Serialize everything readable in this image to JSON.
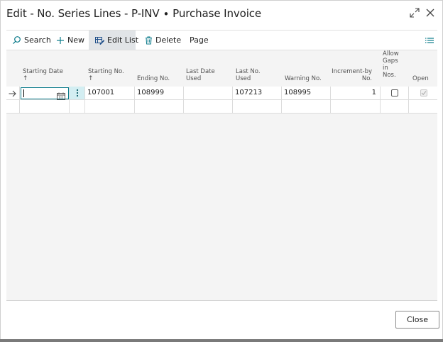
{
  "window": {
    "title": "Edit - No. Series Lines - P-INV ∙ Purchase Invoice"
  },
  "window_icons": [
    "expand-icon",
    "close-icon"
  ],
  "toolbar": {
    "search_label": "Search",
    "new_label": "New",
    "edit_list_label": "Edit List",
    "delete_label": "Delete",
    "page_label": "Page",
    "active_item": "Edit List"
  },
  "columns": {
    "starting_date": "Starting Date",
    "starting_date_sort": "↑",
    "starting_no": "Starting No.",
    "starting_no_sort": "↑",
    "ending_no": "Ending No.",
    "last_date_used_1": "Last Date",
    "last_date_used_2": "Used",
    "last_no_used_1": "Last No.",
    "last_no_used_2": "Used",
    "warning_no": "Warning No.",
    "increment_1": "Increment-by",
    "increment_2": "No.",
    "allow_gaps_1": "Allow",
    "allow_gaps_2": "Gaps",
    "allow_gaps_3": "in",
    "allow_gaps_4": "Nos.",
    "open": "Open"
  },
  "rows": [
    {
      "starting_date": "",
      "starting_no": "107001",
      "ending_no": "108999",
      "last_date_used": "",
      "last_no_used": "107213",
      "warning_no": "108995",
      "increment_by": "1",
      "allow_gaps": false,
      "open": true
    }
  ],
  "footer": {
    "close_label": "Close"
  },
  "colors": {
    "accent": "#0a7a8a",
    "selected_cell": "#d3eef2",
    "toolbar_active": "#e1e4e7"
  }
}
